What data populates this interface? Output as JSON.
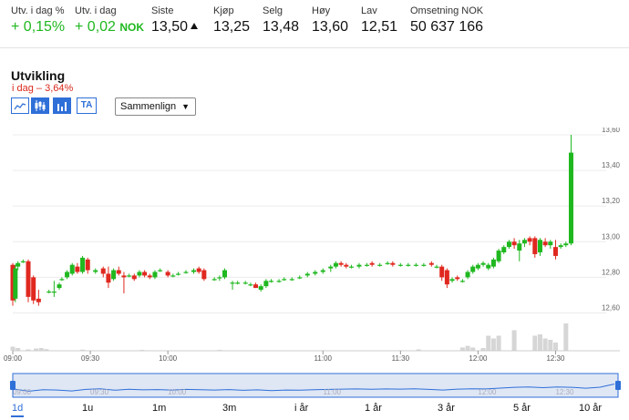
{
  "stats": [
    {
      "label": "Utv. i dag %",
      "value": "+ 0,15%",
      "positive": true
    },
    {
      "label": "Utv. i dag",
      "value": "+ 0,02",
      "unit": "NOK",
      "positive": true
    },
    {
      "label": "Siste",
      "value": "13,50",
      "arrow": "up-triangle-icon"
    },
    {
      "label": "Kjøp",
      "value": "13,25"
    },
    {
      "label": "Selg",
      "value": "13,48"
    },
    {
      "label": "Høy",
      "value": "13,60"
    },
    {
      "label": "Lav",
      "value": "12,51"
    },
    {
      "label": "Omsetning NOK",
      "value": "50 637 166"
    }
  ],
  "section": {
    "title": "Utvikling",
    "today_label": "i dag",
    "today_value": "– 3,64%"
  },
  "toolbar": {
    "buttons": [
      "line-chart-icon",
      "candlestick-icon",
      "volume-bars-icon"
    ],
    "ta_label": "TA",
    "compare_label": "Sammenlign"
  },
  "colors": {
    "up": "#1fb81f",
    "down": "#e0281f",
    "accent": "#2f6fd8",
    "volume": "#d6d6d6"
  },
  "chart_data": {
    "type": "candlestick",
    "ylim": [
      12.5,
      13.6
    ],
    "y_ticks": [
      "13,60",
      "13,40",
      "13,20",
      "13,00",
      "12,80",
      "12,60"
    ],
    "y_tick_values": [
      13.6,
      13.4,
      13.2,
      13.0,
      12.8,
      12.6
    ],
    "x_ticks": [
      "09:00",
      "09:30",
      "10:00",
      "11:00",
      "11:30",
      "12:00",
      "12:30"
    ],
    "x_tick_minutes": [
      0,
      30,
      60,
      120,
      150,
      180,
      210
    ],
    "x_range_minutes": [
      0,
      225
    ],
    "candles": [
      {
        "t": 0,
        "o": 12.87,
        "h": 12.88,
        "l": 12.64,
        "c": 12.67
      },
      {
        "t": 1,
        "o": 12.68,
        "h": 12.87,
        "l": 12.66,
        "c": 12.85
      },
      {
        "t": 2,
        "o": 12.86,
        "h": 12.89,
        "l": 12.84,
        "c": 12.88
      },
      {
        "t": 4,
        "o": 12.89,
        "h": 12.9,
        "l": 12.88,
        "c": 12.89
      },
      {
        "t": 6,
        "o": 12.89,
        "h": 12.9,
        "l": 12.66,
        "c": 12.69
      },
      {
        "t": 8,
        "o": 12.8,
        "h": 12.81,
        "l": 12.65,
        "c": 12.67
      },
      {
        "t": 10,
        "o": 12.68,
        "h": 12.73,
        "l": 12.64,
        "c": 12.66
      },
      {
        "t": 14,
        "o": 12.72,
        "h": 12.73,
        "l": 12.71,
        "c": 12.72
      },
      {
        "t": 16,
        "o": 12.72,
        "h": 12.78,
        "l": 12.69,
        "c": 12.72
      },
      {
        "t": 18,
        "o": 12.74,
        "h": 12.77,
        "l": 12.73,
        "c": 12.76
      },
      {
        "t": 19,
        "o": 12.79,
        "h": 12.8,
        "l": 12.78,
        "c": 12.79
      },
      {
        "t": 21,
        "o": 12.8,
        "h": 12.84,
        "l": 12.79,
        "c": 12.83
      },
      {
        "t": 23,
        "o": 12.82,
        "h": 12.88,
        "l": 12.81,
        "c": 12.87
      },
      {
        "t": 25,
        "o": 12.86,
        "h": 12.88,
        "l": 12.82,
        "c": 12.83
      },
      {
        "t": 27,
        "o": 12.83,
        "h": 12.92,
        "l": 12.82,
        "c": 12.91
      },
      {
        "t": 29,
        "o": 12.9,
        "h": 12.91,
        "l": 12.82,
        "c": 12.84
      },
      {
        "t": 32,
        "o": 12.83,
        "h": 12.85,
        "l": 12.82,
        "c": 12.84
      },
      {
        "t": 35,
        "o": 12.85,
        "h": 12.86,
        "l": 12.8,
        "c": 12.82
      },
      {
        "t": 37,
        "o": 12.82,
        "h": 12.86,
        "l": 12.74,
        "c": 12.77
      },
      {
        "t": 39,
        "o": 12.79,
        "h": 12.85,
        "l": 12.78,
        "c": 12.84
      },
      {
        "t": 41,
        "o": 12.84,
        "h": 12.86,
        "l": 12.81,
        "c": 12.82
      },
      {
        "t": 43,
        "o": 12.81,
        "h": 12.83,
        "l": 12.71,
        "c": 12.8
      },
      {
        "t": 45,
        "o": 12.81,
        "h": 12.82,
        "l": 12.8,
        "c": 12.81
      },
      {
        "t": 47,
        "o": 12.81,
        "h": 12.82,
        "l": 12.78,
        "c": 12.79
      },
      {
        "t": 49,
        "o": 12.81,
        "h": 12.84,
        "l": 12.8,
        "c": 12.83
      },
      {
        "t": 51,
        "o": 12.83,
        "h": 12.84,
        "l": 12.8,
        "c": 12.81
      },
      {
        "t": 53,
        "o": 12.81,
        "h": 12.82,
        "l": 12.79,
        "c": 12.8
      },
      {
        "t": 55,
        "o": 12.8,
        "h": 12.84,
        "l": 12.79,
        "c": 12.83
      },
      {
        "t": 57,
        "o": 12.84,
        "h": 12.85,
        "l": 12.83,
        "c": 12.84
      },
      {
        "t": 60,
        "o": 12.83,
        "h": 12.84,
        "l": 12.8,
        "c": 12.81
      },
      {
        "t": 62,
        "o": 12.81,
        "h": 12.82,
        "l": 12.8,
        "c": 12.81
      },
      {
        "t": 64,
        "o": 12.82,
        "h": 12.83,
        "l": 12.81,
        "c": 12.82
      },
      {
        "t": 67,
        "o": 12.83,
        "h": 12.84,
        "l": 12.82,
        "c": 12.83
      },
      {
        "t": 70,
        "o": 12.83,
        "h": 12.85,
        "l": 12.82,
        "c": 12.84
      },
      {
        "t": 72,
        "o": 12.85,
        "h": 12.86,
        "l": 12.82,
        "c": 12.83
      },
      {
        "t": 74,
        "o": 12.84,
        "h": 12.85,
        "l": 12.78,
        "c": 12.79
      },
      {
        "t": 78,
        "o": 12.79,
        "h": 12.8,
        "l": 12.78,
        "c": 12.79
      },
      {
        "t": 80,
        "o": 12.8,
        "h": 12.81,
        "l": 12.78,
        "c": 12.8
      },
      {
        "t": 82,
        "o": 12.8,
        "h": 12.85,
        "l": 12.79,
        "c": 12.84
      },
      {
        "t": 85,
        "o": 12.77,
        "h": 12.78,
        "l": 12.73,
        "c": 12.77
      },
      {
        "t": 87,
        "o": 12.77,
        "h": 12.78,
        "l": 12.76,
        "c": 12.77
      },
      {
        "t": 90,
        "o": 12.77,
        "h": 12.78,
        "l": 12.76,
        "c": 12.77
      },
      {
        "t": 92,
        "o": 12.76,
        "h": 12.77,
        "l": 12.75,
        "c": 12.76
      },
      {
        "t": 94,
        "o": 12.76,
        "h": 12.77,
        "l": 12.74,
        "c": 12.74
      },
      {
        "t": 96,
        "o": 12.73,
        "h": 12.76,
        "l": 12.72,
        "c": 12.75
      },
      {
        "t": 98,
        "o": 12.75,
        "h": 12.79,
        "l": 12.74,
        "c": 12.78
      },
      {
        "t": 100,
        "o": 12.78,
        "h": 12.79,
        "l": 12.77,
        "c": 12.78
      },
      {
        "t": 103,
        "o": 12.78,
        "h": 12.79,
        "l": 12.77,
        "c": 12.78
      },
      {
        "t": 105,
        "o": 12.79,
        "h": 12.8,
        "l": 12.78,
        "c": 12.79
      },
      {
        "t": 108,
        "o": 12.79,
        "h": 12.8,
        "l": 12.78,
        "c": 12.79
      },
      {
        "t": 111,
        "o": 12.8,
        "h": 12.81,
        "l": 12.79,
        "c": 12.8
      },
      {
        "t": 114,
        "o": 12.81,
        "h": 12.83,
        "l": 12.8,
        "c": 12.82
      },
      {
        "t": 117,
        "o": 12.82,
        "h": 12.84,
        "l": 12.81,
        "c": 12.83
      },
      {
        "t": 120,
        "o": 12.83,
        "h": 12.85,
        "l": 12.82,
        "c": 12.84
      },
      {
        "t": 123,
        "o": 12.85,
        "h": 12.87,
        "l": 12.83,
        "c": 12.86
      },
      {
        "t": 125,
        "o": 12.86,
        "h": 12.89,
        "l": 12.85,
        "c": 12.88
      },
      {
        "t": 127,
        "o": 12.88,
        "h": 12.89,
        "l": 12.86,
        "c": 12.87
      },
      {
        "t": 129,
        "o": 12.87,
        "h": 12.88,
        "l": 12.85,
        "c": 12.86
      },
      {
        "t": 131,
        "o": 12.86,
        "h": 12.87,
        "l": 12.85,
        "c": 12.86
      },
      {
        "t": 134,
        "o": 12.86,
        "h": 12.88,
        "l": 12.85,
        "c": 12.87
      },
      {
        "t": 137,
        "o": 12.87,
        "h": 12.88,
        "l": 12.86,
        "c": 12.87
      },
      {
        "t": 139,
        "o": 12.88,
        "h": 12.89,
        "l": 12.86,
        "c": 12.87
      },
      {
        "t": 142,
        "o": 12.87,
        "h": 12.88,
        "l": 12.86,
        "c": 12.87
      },
      {
        "t": 145,
        "o": 12.88,
        "h": 12.89,
        "l": 12.87,
        "c": 12.88
      },
      {
        "t": 147,
        "o": 12.88,
        "h": 12.89,
        "l": 12.86,
        "c": 12.87
      },
      {
        "t": 150,
        "o": 12.87,
        "h": 12.88,
        "l": 12.86,
        "c": 12.87
      },
      {
        "t": 153,
        "o": 12.87,
        "h": 12.88,
        "l": 12.86,
        "c": 12.87
      },
      {
        "t": 156,
        "o": 12.87,
        "h": 12.88,
        "l": 12.86,
        "c": 12.87
      },
      {
        "t": 159,
        "o": 12.87,
        "h": 12.88,
        "l": 12.86,
        "c": 12.87
      },
      {
        "t": 162,
        "o": 12.88,
        "h": 12.89,
        "l": 12.86,
        "c": 12.87
      },
      {
        "t": 164,
        "o": 12.86,
        "h": 12.87,
        "l": 12.85,
        "c": 12.86
      },
      {
        "t": 166,
        "o": 12.86,
        "h": 12.87,
        "l": 12.78,
        "c": 12.8
      },
      {
        "t": 168,
        "o": 12.84,
        "h": 12.85,
        "l": 12.74,
        "c": 12.76
      },
      {
        "t": 170,
        "o": 12.78,
        "h": 12.8,
        "l": 12.77,
        "c": 12.79
      },
      {
        "t": 172,
        "o": 12.8,
        "h": 12.81,
        "l": 12.78,
        "c": 12.79
      },
      {
        "t": 174,
        "o": 12.78,
        "h": 12.79,
        "l": 12.77,
        "c": 12.78
      },
      {
        "t": 176,
        "o": 12.8,
        "h": 12.84,
        "l": 12.79,
        "c": 12.83
      },
      {
        "t": 178,
        "o": 12.83,
        "h": 12.87,
        "l": 12.82,
        "c": 12.86
      },
      {
        "t": 180,
        "o": 12.85,
        "h": 12.88,
        "l": 12.84,
        "c": 12.87
      },
      {
        "t": 182,
        "o": 12.87,
        "h": 12.89,
        "l": 12.86,
        "c": 12.88
      },
      {
        "t": 184,
        "o": 12.85,
        "h": 12.88,
        "l": 12.84,
        "c": 12.87
      },
      {
        "t": 186,
        "o": 12.86,
        "h": 12.91,
        "l": 12.85,
        "c": 12.9
      },
      {
        "t": 188,
        "o": 12.89,
        "h": 12.96,
        "l": 12.88,
        "c": 12.95
      },
      {
        "t": 190,
        "o": 12.94,
        "h": 12.98,
        "l": 12.93,
        "c": 12.97
      },
      {
        "t": 192,
        "o": 12.97,
        "h": 13.01,
        "l": 12.96,
        "c": 13.0
      },
      {
        "t": 194,
        "o": 13.0,
        "h": 13.02,
        "l": 12.96,
        "c": 12.98
      },
      {
        "t": 196,
        "o": 12.95,
        "h": 13.01,
        "l": 12.89,
        "c": 12.99
      },
      {
        "t": 198,
        "o": 12.99,
        "h": 13.02,
        "l": 12.97,
        "c": 13.01
      },
      {
        "t": 200,
        "o": 13.02,
        "h": 13.03,
        "l": 12.98,
        "c": 13.0
      },
      {
        "t": 202,
        "o": 13.02,
        "h": 13.03,
        "l": 12.91,
        "c": 12.93
      },
      {
        "t": 204,
        "o": 12.94,
        "h": 13.02,
        "l": 12.92,
        "c": 13.01
      },
      {
        "t": 206,
        "o": 13.0,
        "h": 13.02,
        "l": 12.97,
        "c": 12.98
      },
      {
        "t": 208,
        "o": 12.98,
        "h": 13.01,
        "l": 12.96,
        "c": 13.0
      },
      {
        "t": 210,
        "o": 12.97,
        "h": 13.01,
        "l": 12.9,
        "c": 12.92
      },
      {
        "t": 212,
        "o": 12.97,
        "h": 12.99,
        "l": 12.96,
        "c": 12.98
      },
      {
        "t": 214,
        "o": 12.98,
        "h": 13.0,
        "l": 12.97,
        "c": 12.99
      },
      {
        "t": 216,
        "o": 12.99,
        "h": 13.6,
        "l": 12.98,
        "c": 13.5
      }
    ],
    "volume": [
      {
        "t": 0,
        "v": 0.15
      },
      {
        "t": 2,
        "v": 0.1
      },
      {
        "t": 6,
        "v": 0.05
      },
      {
        "t": 9,
        "v": 0.08
      },
      {
        "t": 11,
        "v": 0.1
      },
      {
        "t": 13,
        "v": 0.06
      },
      {
        "t": 27,
        "v": 0.04
      },
      {
        "t": 50,
        "v": 0.03
      },
      {
        "t": 80,
        "v": 0.03
      },
      {
        "t": 120,
        "v": 0.02
      },
      {
        "t": 150,
        "v": 0.02
      },
      {
        "t": 157,
        "v": 0.05
      },
      {
        "t": 174,
        "v": 0.12
      },
      {
        "t": 176,
        "v": 0.18
      },
      {
        "t": 178,
        "v": 0.12
      },
      {
        "t": 182,
        "v": 0.1
      },
      {
        "t": 184,
        "v": 0.55
      },
      {
        "t": 186,
        "v": 0.45
      },
      {
        "t": 188,
        "v": 0.55
      },
      {
        "t": 194,
        "v": 0.75
      },
      {
        "t": 202,
        "v": 0.55
      },
      {
        "t": 204,
        "v": 0.6
      },
      {
        "t": 206,
        "v": 0.45
      },
      {
        "t": 208,
        "v": 0.4
      },
      {
        "t": 210,
        "v": 0.3
      },
      {
        "t": 214,
        "v": 1.0
      }
    ],
    "navigator": {
      "x_ticks": [
        "09:00",
        "09:30",
        "10:00",
        "11:00",
        "12:00",
        "12:30"
      ],
      "x_tick_minutes": [
        0,
        30,
        60,
        120,
        180,
        210
      ],
      "line": [
        12.86,
        12.72,
        12.82,
        12.8,
        12.74,
        12.84,
        12.88,
        12.79,
        12.85,
        12.81,
        12.83,
        12.8,
        12.84,
        12.82,
        12.8,
        12.83,
        12.78,
        12.81,
        12.76,
        12.8,
        12.79,
        12.82,
        12.84,
        12.86,
        12.87,
        12.85,
        12.87,
        12.86,
        12.88,
        12.84,
        12.8,
        12.86,
        12.88,
        12.87,
        12.93,
        12.98,
        13.0,
        12.96,
        13.01,
        12.98,
        12.92,
        12.99,
        13.2
      ]
    }
  },
  "timeframes": [
    "1d",
    "1u",
    "1m",
    "3m",
    "i år",
    "1 år",
    "3 år",
    "5 år",
    "10 år"
  ]
}
